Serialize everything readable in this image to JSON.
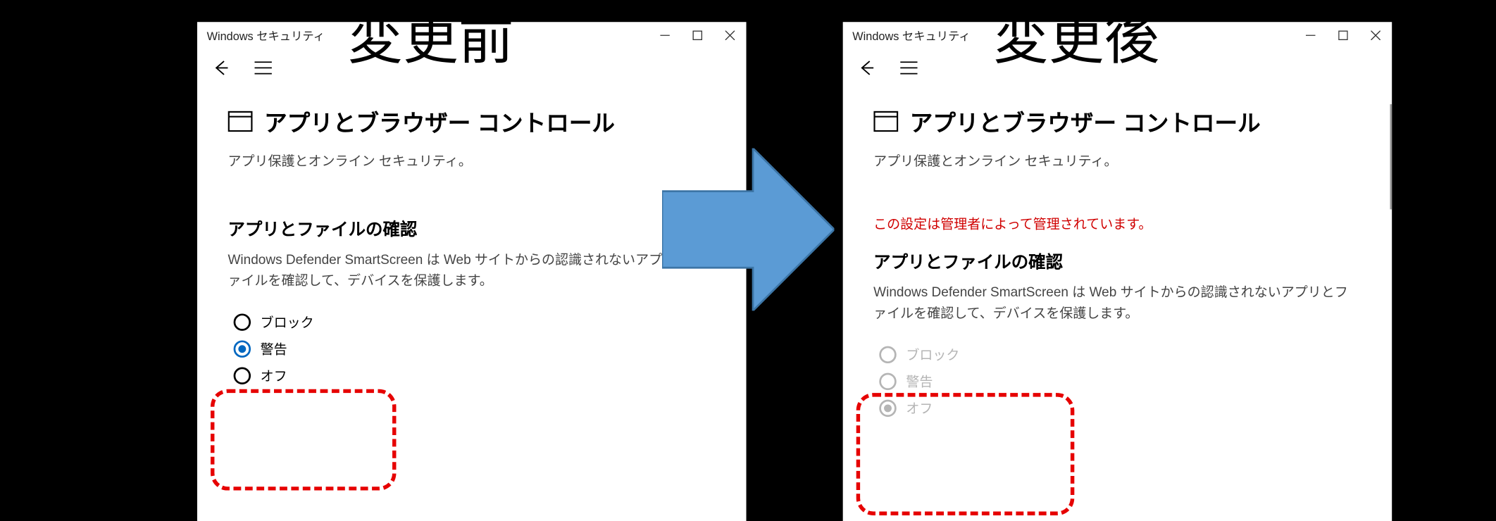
{
  "overlay": {
    "before": "変更前",
    "after": "変更後"
  },
  "window": {
    "title": "Windows セキュリティ",
    "content": {
      "heading": "アプリとブラウザー コントロール",
      "subtitle": "アプリ保護とオンライン セキュリティ。",
      "section_title": "アプリとファイルの確認",
      "section_desc": "Windows Defender SmartScreen は Web サイトからの認識されないアプリとファイルを確認して、デバイスを保護します。",
      "admin_notice": "この設定は管理者によって管理されています。",
      "options": {
        "block": "ブロック",
        "warn": "警告",
        "off": "オフ"
      }
    }
  },
  "state": {
    "before": {
      "selected": "warn",
      "disabled": false,
      "show_admin_notice": false
    },
    "after": {
      "selected": "off",
      "disabled": true,
      "show_admin_notice": true
    }
  }
}
